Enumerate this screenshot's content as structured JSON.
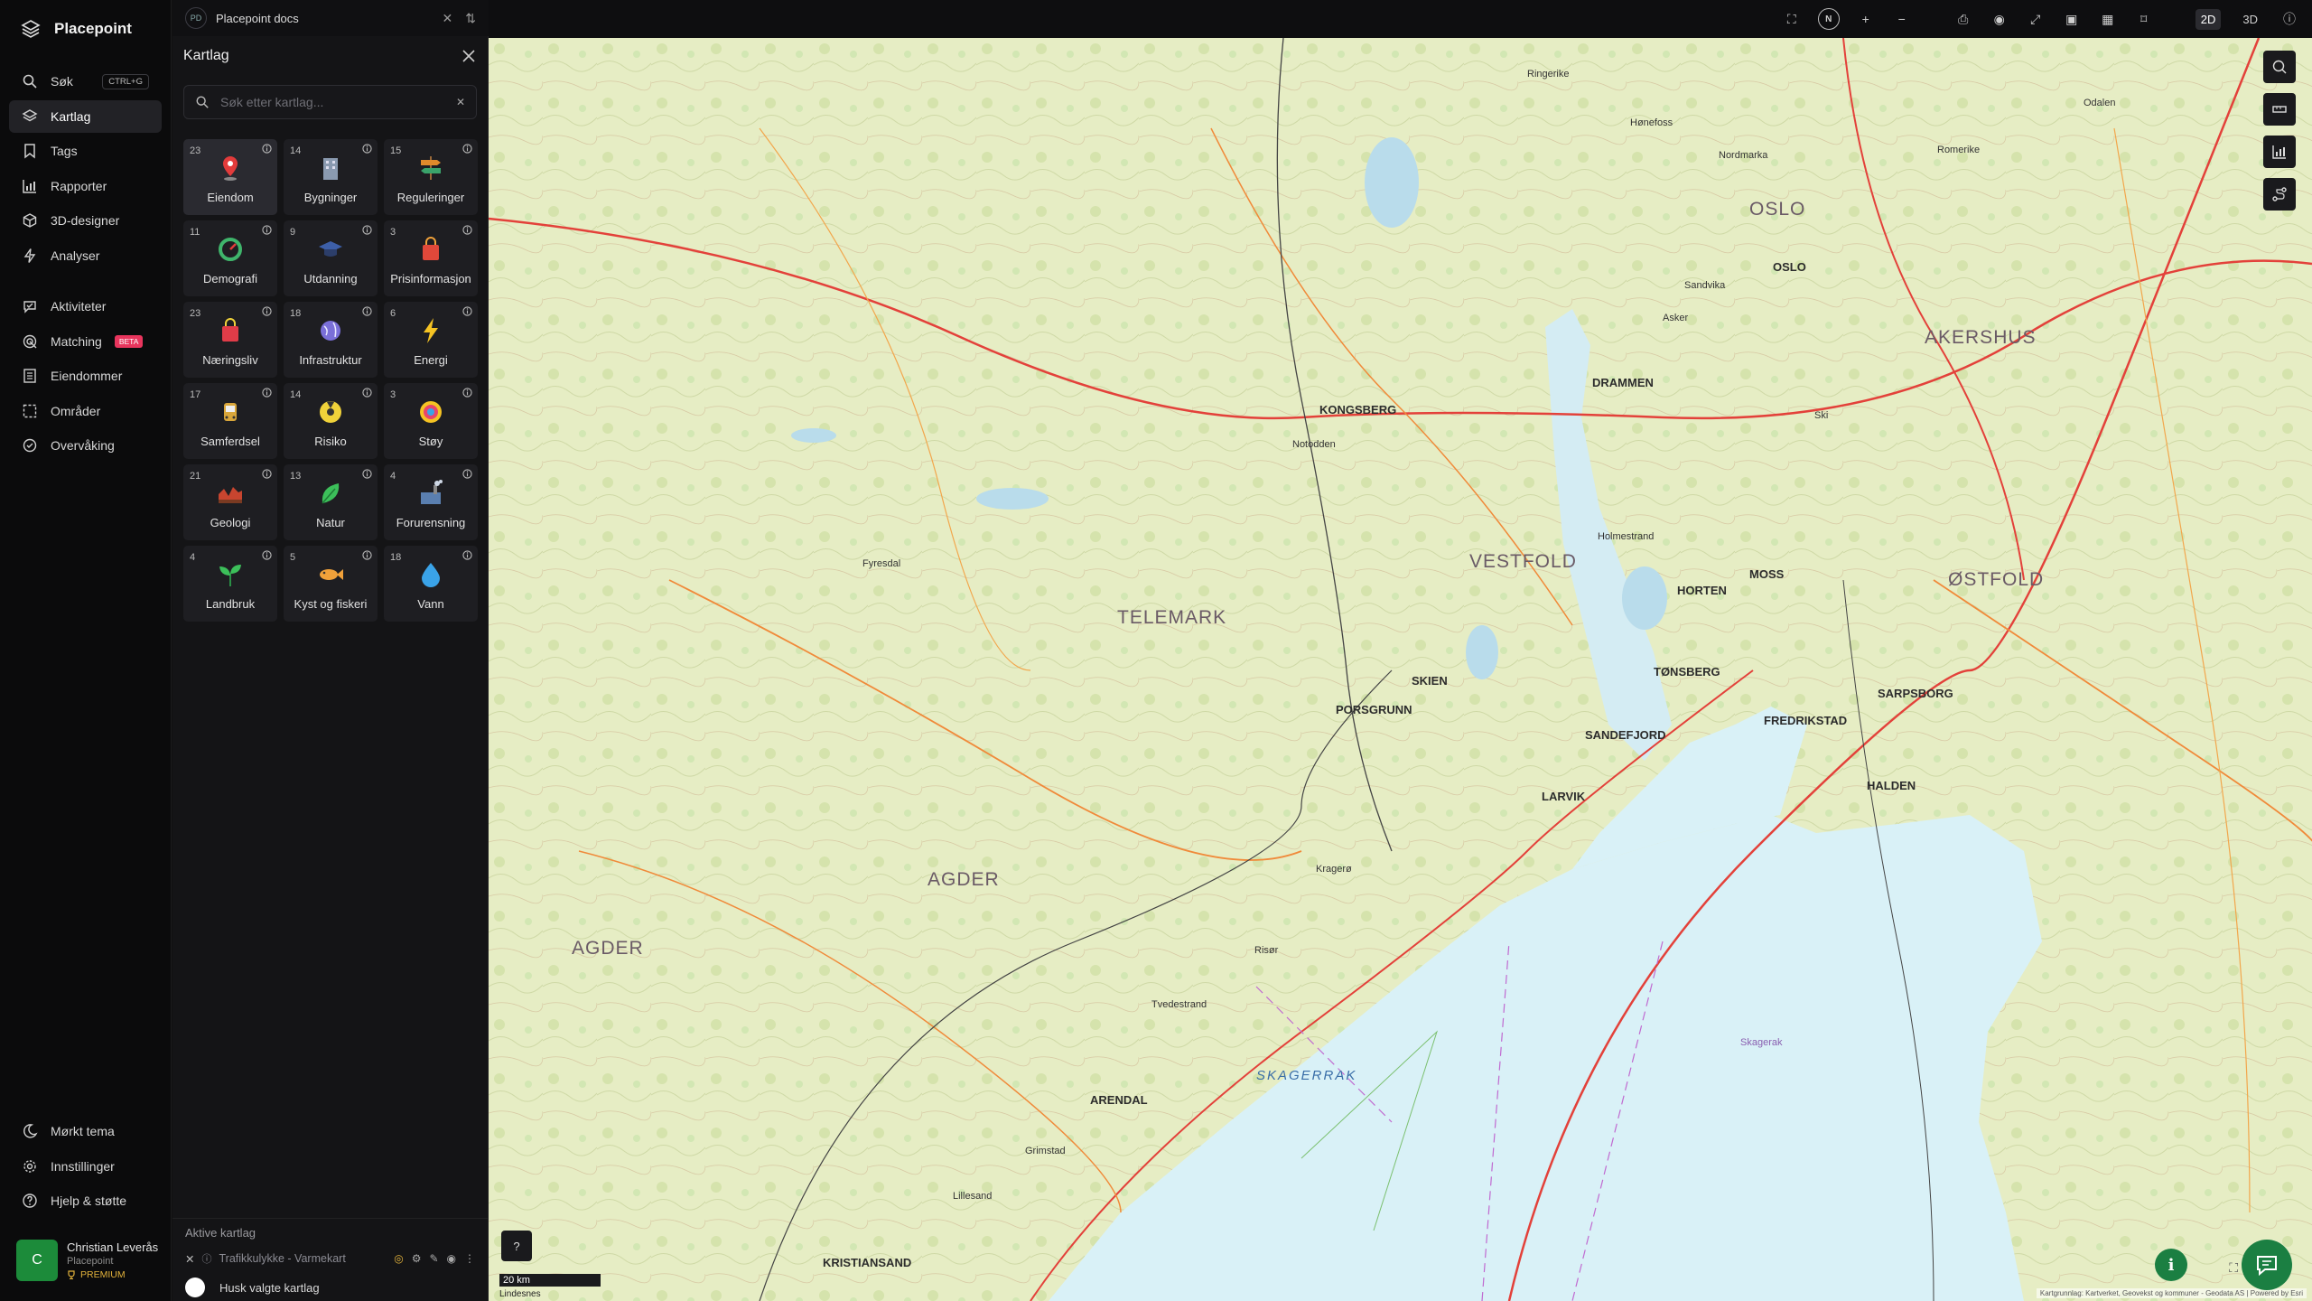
{
  "app": {
    "name": "Placepoint"
  },
  "nav": {
    "search": {
      "label": "Søk",
      "shortcut": "CTRL+G"
    },
    "items": [
      {
        "label": "Kartlag",
        "icon": "layers-icon"
      },
      {
        "label": "Tags",
        "icon": "bookmark-icon"
      },
      {
        "label": "Rapporter",
        "icon": "bar-chart-icon"
      },
      {
        "label": "3D-designer",
        "icon": "cube-icon"
      },
      {
        "label": "Analyser",
        "icon": "bolt-icon"
      }
    ],
    "items2": [
      {
        "label": "Aktiviteter",
        "icon": "activity-icon"
      },
      {
        "label": "Matching",
        "icon": "radar-icon",
        "badge": "BETA"
      },
      {
        "label": "Eiendommer",
        "icon": "building-icon"
      },
      {
        "label": "Områder",
        "icon": "area-icon"
      },
      {
        "label": "Overvåking",
        "icon": "monitor-icon"
      }
    ],
    "bottom": [
      {
        "label": "Mørkt tema",
        "icon": "moon-icon"
      },
      {
        "label": "Innstillinger",
        "icon": "gear-icon"
      },
      {
        "label": "Hjelp & støtte",
        "icon": "help-icon"
      }
    ]
  },
  "user": {
    "initial": "C",
    "name": "Christian Leverås",
    "org": "Placepoint",
    "plan": "PREMIUM"
  },
  "doc_tab": {
    "badge": "PD",
    "title": "Placepoint docs"
  },
  "panel": {
    "title": "Kartlag",
    "search_placeholder": "Søk etter kartlag...",
    "tiles": [
      {
        "count": "23",
        "label": "Eiendom",
        "icon": "pin-icon",
        "color": "#e23b3b"
      },
      {
        "count": "14",
        "label": "Bygninger",
        "icon": "building-icon",
        "color": "#8a9ab0"
      },
      {
        "count": "15",
        "label": "Reguleringer",
        "icon": "signpost-icon",
        "color": "#e08a2b"
      },
      {
        "count": "11",
        "label": "Demografi",
        "icon": "gauge-icon",
        "color": "#3fb56b"
      },
      {
        "count": "9",
        "label": "Utdanning",
        "icon": "graduation-cap-icon",
        "color": "#3d5fa8"
      },
      {
        "count": "3",
        "label": "Prisinformasjon",
        "icon": "shopping-bag-icon",
        "color": "#e0483a"
      },
      {
        "count": "23",
        "label": "Næringsliv",
        "icon": "shop-bag-icon",
        "color": "#e03c48"
      },
      {
        "count": "18",
        "label": "Infrastruktur",
        "icon": "globe-icon",
        "color": "#7a6fd8"
      },
      {
        "count": "6",
        "label": "Energi",
        "icon": "lightning-icon",
        "color": "#f5c323"
      },
      {
        "count": "17",
        "label": "Samferdsel",
        "icon": "bus-icon",
        "color": "#d9a63a"
      },
      {
        "count": "14",
        "label": "Risiko",
        "icon": "hazard-icon",
        "color": "#f0d23a"
      },
      {
        "count": "3",
        "label": "Støy",
        "icon": "noise-icon",
        "color": "#e9a53a"
      },
      {
        "count": "21",
        "label": "Geologi",
        "icon": "terrain-icon",
        "color": "#c8452f"
      },
      {
        "count": "13",
        "label": "Natur",
        "icon": "leaf-icon",
        "color": "#3cbf5a"
      },
      {
        "count": "4",
        "label": "Forurensning",
        "icon": "factory-icon",
        "color": "#5a7fb0"
      },
      {
        "count": "4",
        "label": "Landbruk",
        "icon": "sprout-icon",
        "color": "#3cbf5a"
      },
      {
        "count": "5",
        "label": "Kyst og fiskeri",
        "icon": "fish-icon",
        "color": "#f0a13a"
      },
      {
        "count": "18",
        "label": "Vann",
        "icon": "water-drop-icon",
        "color": "#3aa3e8"
      }
    ],
    "active": {
      "title": "Aktive kartlag",
      "layer": "Trafikkulykke - Varmekart",
      "remember": "Husk valgte kartlag"
    }
  },
  "toolbar": {
    "compass": "N",
    "mode_2d": "2D",
    "mode_3d": "3D"
  },
  "map": {
    "labels": {
      "oslo": "OSLO",
      "akershus": "AKERSHUS",
      "vestfold": "VESTFOLD",
      "ostfold": "ØSTFOLD",
      "telemark": "TELEMARK",
      "agder1": "AGDER",
      "agder2": "AGDER",
      "skagerrak": "SKAGERRAK",
      "drammen": "DRAMMEN",
      "kongsberg": "KONGSBERG",
      "notodden": "Notodden",
      "skien": "SKIEN",
      "porsgrunn": "PORSGRUNN",
      "larvik": "LARVIK",
      "sandefjord": "SANDEFJORD",
      "tonsberg": "TØNSBERG",
      "horten": "HORTEN",
      "moss": "MOSS",
      "fredrikstad": "FREDRIKSTAD",
      "sarpsborg": "SARPSBORG",
      "halden": "HALDEN",
      "arendal": "ARENDAL",
      "grimstad": "Grimstad",
      "kristiansand": "KRISTIANSAND",
      "lillesand": "Lillesand",
      "risor": "Risør",
      "kragero": "Kragerø",
      "honefoss": "Hønefoss",
      "ringerike": "Ringerike",
      "nordmarka": "Nordmarka",
      "odalen": "Odalen",
      "romerike": "Romerike",
      "sandvika": "Sandvika",
      "asker": "Asker",
      "ski": "Ski",
      "holmestrand": "Holmestrand",
      "tvedestrand": "Tvedestrand",
      "fyresdal": "Fyresdal",
      "skagerak2": "Skagerak"
    },
    "scale": "20 km",
    "scale_end": "Lindesnes",
    "attribution": "Kartgrunnlag: Kartverket, Geovekst og kommuner - Geodata AS | Powered by Esri"
  }
}
